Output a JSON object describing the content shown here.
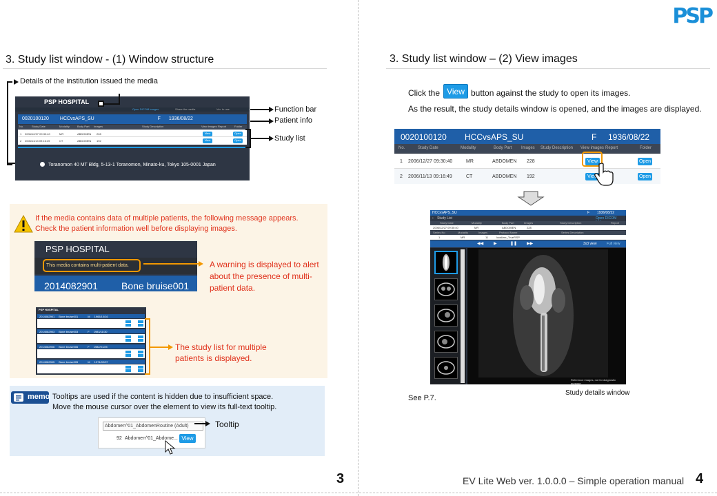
{
  "logo": "PSP",
  "left": {
    "title": "3. Study list window - (1) Window structure",
    "callouts": {
      "institution": "Details of the institution issued the media",
      "function_bar": "Function bar",
      "patient_info": "Patient info",
      "study_list": "Study list"
    },
    "window": {
      "hospital": "PSP HOSPITAL",
      "tabs": [
        "Open DICOM images",
        "Share the media",
        "Ver. to use"
      ],
      "patient_id": "0020100120",
      "patient_name": "HCCvsAPS_SU",
      "sex": "F",
      "dob": "1936/08/22",
      "headers": [
        "No.",
        "Study Date",
        "Modality",
        "Body Part",
        "Images",
        "Study Description",
        "View images",
        "Report",
        "Folder"
      ],
      "rows": [
        [
          "1",
          "2006/12/27 09:30:40",
          "MR",
          "ABDOMEN",
          "228",
          "",
          "View",
          "",
          "Open"
        ],
        [
          "2",
          "2006/11/13 09:16:49",
          "CT",
          "ABDOMEN",
          "192",
          "",
          "View",
          "",
          "Open"
        ]
      ],
      "address": "Toranomon 40 MT Bldg, 5-13-1 Toranomon, Minato-ku, Tokyo 105-0001 Japan"
    },
    "warning": {
      "message_line1": "If the media contains data of multiple patients, the following message appears.",
      "message_line2": "Check the patient information well before displaying images.",
      "hospital": "PSP HOSPITAL",
      "banner": "This media contains multi-patient data.",
      "patient_id": "2014082901",
      "patient_name": "Bone bruise001",
      "note_line1": "A warning is displayed to alert",
      "note_line2": "about the presence of multi-",
      "note_line3": "patient data.",
      "list_note_line1": "The study list for multiple",
      "list_note_line2": "patients is displayed.",
      "mini_hospital": "PSP HOSPITAL",
      "mini_patients": [
        {
          "id": "2014082901",
          "name": "Bone bruise001",
          "sex": "M",
          "dob": "1965/10/16"
        },
        {
          "id": "2014082903",
          "name": "Bone bruise003",
          "sex": "F",
          "dob": "1983/11/30"
        },
        {
          "id": "2014082906",
          "name": "Bone bruise006",
          "sex": "F",
          "dob": "1982/01/25"
        },
        {
          "id": "2014082905",
          "name": "Bone bruise005",
          "sex": "M",
          "dob": "1974/02/07"
        }
      ]
    },
    "memo": {
      "badge": "memo",
      "line1": "Tooltips are used if the content is hidden due to insufficient space.",
      "line2": "Move the mouse cursor over the element to view its full-text tooltip.",
      "tooltip_label": "Tooltip",
      "tooltip_text": "Abdomen^01_AbdomenRoutine (Adult)",
      "cell_num": "92",
      "cell_text": "Abdomen^01_Abdome...",
      "view": "View"
    },
    "page_number": "3"
  },
  "right": {
    "title": "3. Study list window – (2) View images",
    "click_pre": "Click the",
    "view_btn": "View",
    "click_post": "button against the study to open its images.",
    "result": "As the result, the study details window is opened, and the images are displayed.",
    "study_window": {
      "patient_id": "0020100120",
      "patient_name": "HCCvsAPS_SU",
      "sex": "F",
      "dob": "1936/08/22",
      "headers": [
        "No.",
        "Study Date",
        "Modality",
        "Body Part",
        "Images",
        "Study Description",
        "View images",
        "Report",
        "Folder"
      ],
      "rows": [
        [
          "1",
          "2006/12/27 09:30:40",
          "MR",
          "ABDOMEN",
          "228",
          "",
          "View",
          "",
          "Open"
        ],
        [
          "2",
          "2006/11/13 09:16:49",
          "CT",
          "ABDOMEN",
          "192",
          "",
          "View",
          "",
          "Open"
        ]
      ]
    },
    "details_window": {
      "title": "HCCvsAPS_SU",
      "sex": "F",
      "dob": "1936/08/22",
      "back": "Study List",
      "open_link": "Open DICOM folder",
      "study_headers": [
        "Study Date",
        "Modality",
        "Body Part",
        "Images",
        "Study Description",
        "Report"
      ],
      "study_row": [
        "2006/12/27 09:30:40",
        "MR",
        "ABDOMEN",
        "228",
        "",
        ""
      ],
      "series_headers": [
        "Series No",
        "Modality",
        "Images",
        "Protocol Name",
        "Series Description"
      ],
      "series_row": [
        "1",
        "MR",
        "11",
        "localizer_TrueFISP",
        ""
      ],
      "view_mode": "3x3 view",
      "full_view": "Full view",
      "disclaimer": "Reference images, not for diagnostic purpose"
    },
    "see": "See P.7.",
    "caption": "Study details window",
    "footer": "EV Lite Web ver. 1.0.0.0 – Simple operation manual",
    "page_number": "4"
  }
}
